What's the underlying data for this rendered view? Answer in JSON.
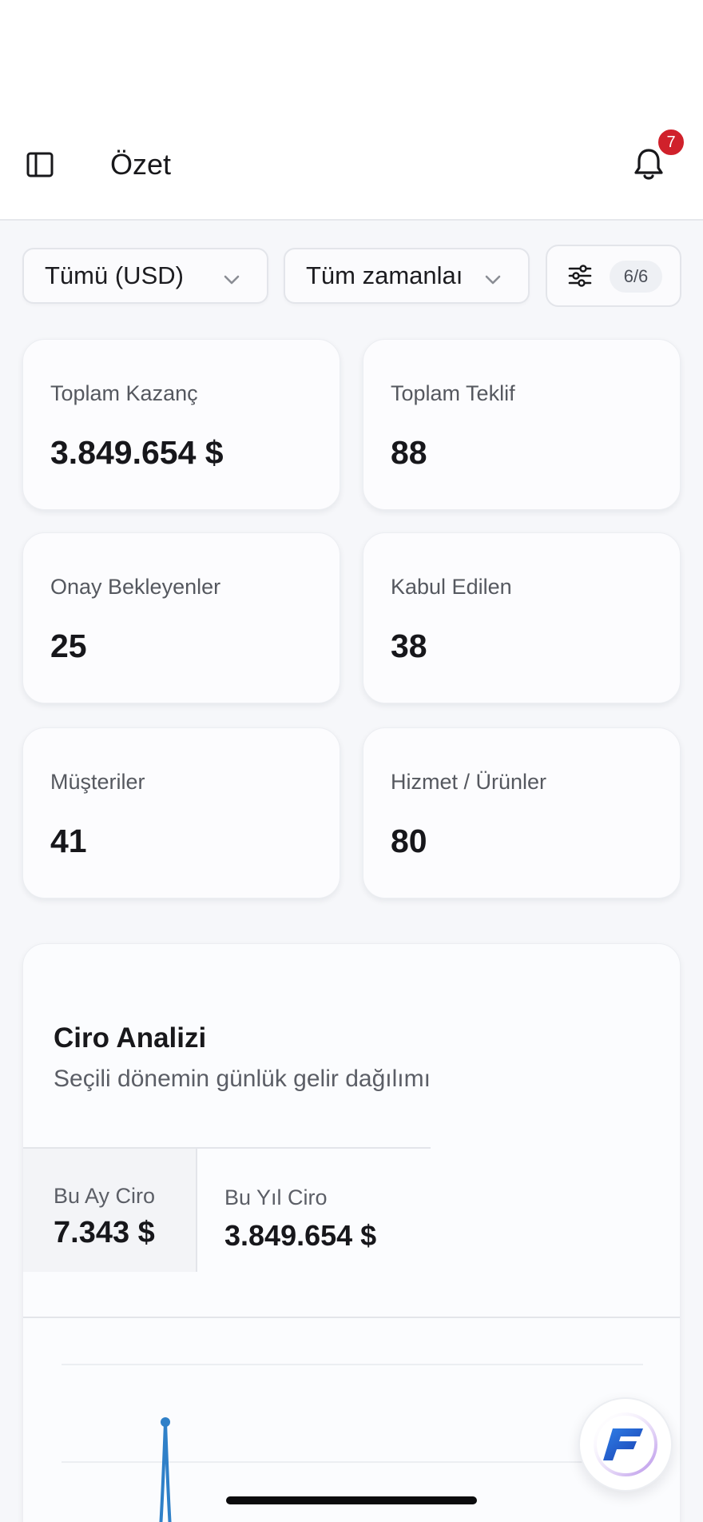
{
  "header": {
    "title": "Özet",
    "notification_count": "7"
  },
  "filters": {
    "currency": "Tümü (USD)",
    "period": "Tüm zamanlaı",
    "columns_count": "6/6"
  },
  "stats": [
    {
      "label": "Toplam Kazanç",
      "value": "3.849.654 $"
    },
    {
      "label": "Toplam Teklif",
      "value": "88"
    },
    {
      "label": "Onay Bekleyenler",
      "value": "25"
    },
    {
      "label": "Kabul Edilen",
      "value": "38"
    },
    {
      "label": "Müşteriler",
      "value": "41"
    },
    {
      "label": "Hizmet / Ürünler",
      "value": "80"
    }
  ],
  "revenue": {
    "title": "Ciro Analizi",
    "subtitle": "Seçili dönemin günlük gelir dağılımı",
    "month_label": "Bu Ay Ciro",
    "month_value": "7.343 $",
    "year_label": "Bu Yıl Ciro",
    "year_value": "3.849.654 $"
  },
  "colors": {
    "accent": "#2f80c8",
    "badge": "#d0212b",
    "background": "#f6f7fa"
  },
  "icons": {
    "sidebar_toggle": "sidebar-toggle-icon",
    "notifications": "bell-icon",
    "dropdown": "chevron-down-icon",
    "columns": "sliders-icon",
    "fab": "brand-logo-icon"
  }
}
